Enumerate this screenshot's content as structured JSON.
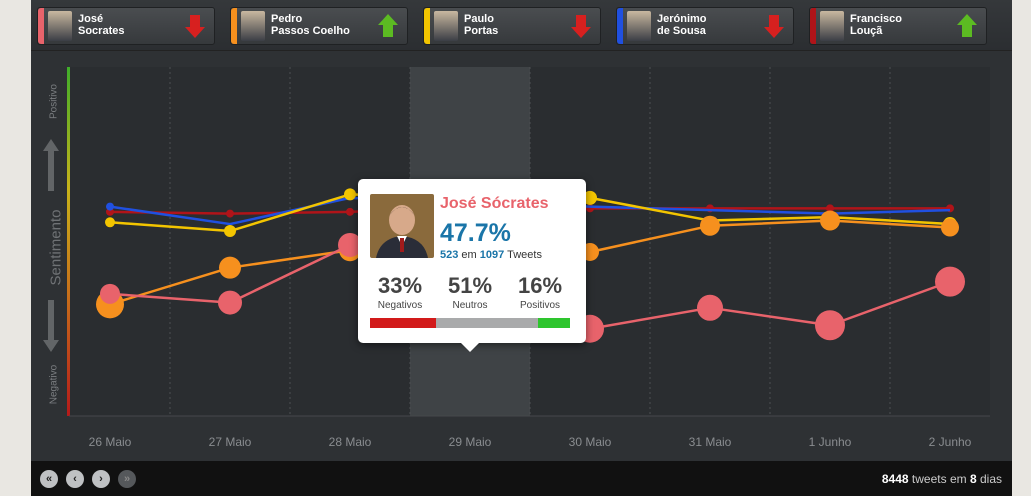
{
  "candidates": [
    {
      "first": "José",
      "last": "Socrates",
      "color": "#e8636b",
      "trend": "down",
      "arrow_color": "#d7201f"
    },
    {
      "first": "Pedro",
      "last": "Passos Coelho",
      "color": "#f6901e",
      "trend": "up",
      "arrow_color": "#5cbb22"
    },
    {
      "first": "Paulo",
      "last": "Portas",
      "color": "#f3c500",
      "trend": "down",
      "arrow_color": "#d7201f"
    },
    {
      "first": "Jerónimo",
      "last": "de Sousa",
      "color": "#2050e0",
      "trend": "down",
      "arrow_color": "#d7201f"
    },
    {
      "first": "Francisco",
      "last": "Louçã",
      "color": "#b01419",
      "trend": "up",
      "arrow_color": "#5cbb22"
    }
  ],
  "axis": {
    "ylabel": "Sentimento",
    "positive": "Positivo",
    "negative": "Negativo"
  },
  "chart_data": {
    "type": "line",
    "x": [
      "26 Maio",
      "27 Maio",
      "28 Maio",
      "29 Maio",
      "30 Maio",
      "31 Maio",
      "1 Junho",
      "2 Junho"
    ],
    "highlighted": "29 Maio",
    "ylim": [
      -1,
      1
    ],
    "series": [
      {
        "name": "José Socrates",
        "color": "#e8636b",
        "values": [
          -0.3,
          -0.35,
          -0.02,
          -0.3,
          -0.5,
          -0.38,
          -0.48,
          -0.23
        ],
        "sizes": [
          10,
          12,
          12,
          12,
          14,
          13,
          15,
          15
        ]
      },
      {
        "name": "Pedro Passos Coelho",
        "color": "#f6901e",
        "values": [
          -0.36,
          -0.15,
          -0.05,
          -0.05,
          -0.06,
          0.09,
          0.12,
          0.08
        ],
        "sizes": [
          14,
          11,
          11,
          11,
          9,
          10,
          10,
          9
        ]
      },
      {
        "name": "Paulo Portas",
        "color": "#f3c500",
        "values": [
          0.11,
          0.06,
          0.27,
          0.25,
          0.25,
          0.12,
          0.14,
          0.1
        ],
        "sizes": [
          5,
          6,
          6,
          6,
          7,
          0,
          0,
          7
        ]
      },
      {
        "name": "Jerónimo de Sousa",
        "color": "#2050e0",
        "values": [
          0.2,
          0.1,
          0.25,
          0.22,
          0.2,
          0.18,
          0.16,
          0.18
        ],
        "sizes": [
          4,
          0,
          0,
          0,
          0,
          0,
          0,
          0
        ]
      },
      {
        "name": "Francisco Louçã",
        "color": "#b01419",
        "values": [
          0.17,
          0.16,
          0.17,
          0.2,
          0.19,
          0.19,
          0.19,
          0.19
        ],
        "sizes": [
          4,
          4,
          4,
          4,
          4,
          4,
          4,
          4
        ]
      }
    ]
  },
  "tooltip": {
    "name": "José Sócrates",
    "pct": "47.7%",
    "count": "523",
    "count_sep": "em",
    "total": "1097",
    "count_unit": "Tweets",
    "neg_value": "33%",
    "neg_label": "Negativos",
    "neg_fraction": 0.33,
    "neu_value": "51%",
    "neu_label": "Neutros",
    "neu_fraction": 0.51,
    "pos_value": "16%",
    "pos_label": "Positivos",
    "pos_fraction": 0.16,
    "neg_color": "#d21a1a",
    "neu_color": "#a9aaab",
    "pos_color": "#2ec52e"
  },
  "footer": {
    "tweets": "8448",
    "tweets_label": "tweets em",
    "days": "8",
    "days_label": "dias",
    "nav": [
      "«",
      "‹",
      "›",
      "»"
    ]
  }
}
